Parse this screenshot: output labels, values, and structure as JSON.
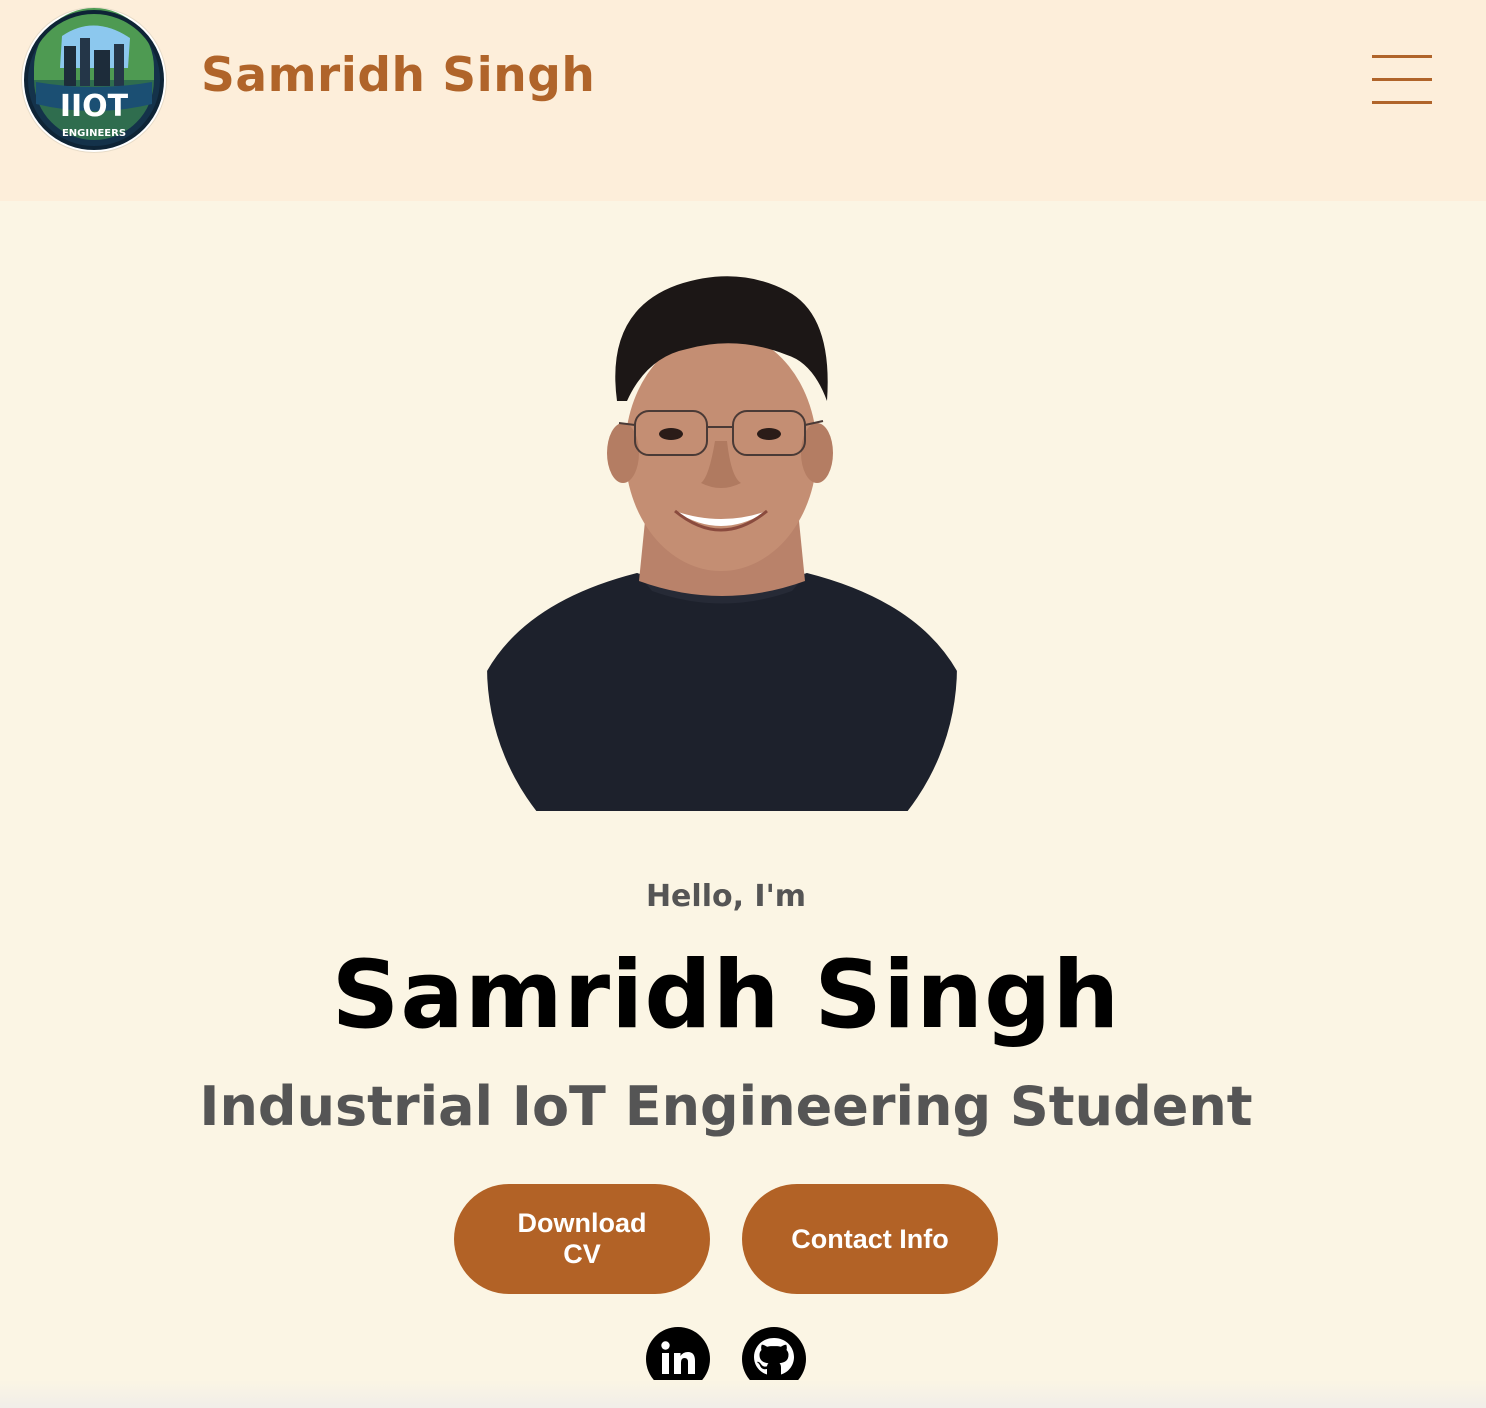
{
  "header": {
    "logo_text": "IIOT",
    "logo_subtext": "ENGINEERS",
    "brand_name": "Samridh Singh",
    "menu_icon": "hamburger-menu-icon"
  },
  "hero": {
    "portrait_icon": "profile-photo",
    "greeting": "Hello, I'm",
    "name": "Samridh Singh",
    "subtitle": "Industrial IoT Engineering Student"
  },
  "buttons": {
    "download_cv": "Download CV",
    "contact_info": "Contact Info"
  },
  "social": {
    "linkedin_icon": "linkedin-icon",
    "github_icon": "github-icon"
  },
  "colors": {
    "header_bg": "#fdeeda",
    "page_bg": "#fbf5e4",
    "accent": "#b0642a",
    "button": "#b26226",
    "text_dark": "#000000",
    "text_muted": "#555555"
  }
}
